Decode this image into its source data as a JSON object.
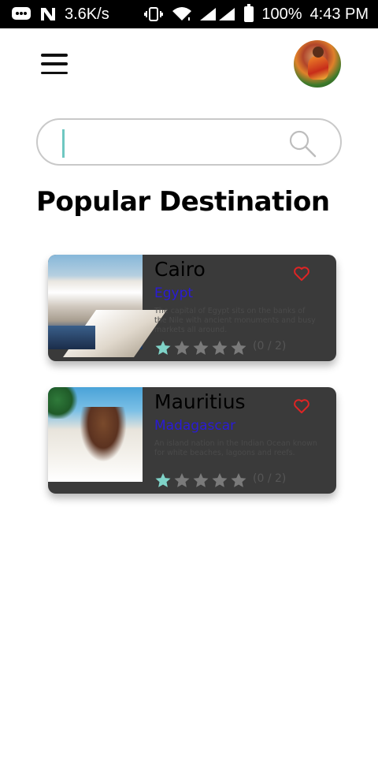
{
  "status_bar": {
    "network_speed": "3.6K/s",
    "battery": "100%",
    "time": "4:43 PM",
    "icons": [
      "message-icon",
      "n-icon",
      "vibrate-icon",
      "wifi-icon",
      "signal-icon",
      "battery-icon"
    ]
  },
  "header": {
    "menu_icon": "hamburger-menu-icon",
    "avatar": "user-avatar"
  },
  "search": {
    "value": "",
    "placeholder": "",
    "icon": "search-icon"
  },
  "page_title": "Popular Destination",
  "colors": {
    "card_bg": "#3a3a3a",
    "country": "#2a1bd6",
    "heart": "#e02424",
    "star_filled": "#7fd3c8",
    "star_empty": "#7a7a7a"
  },
  "destinations": [
    {
      "name": "Cairo",
      "country": "Egypt",
      "description": "The capital of Egypt sits on the banks of the Nile with ancient monuments and busy markets all around.",
      "rating": 1,
      "rating_max": 5,
      "rating_text": "(0 / 2)",
      "image": "cairo-coast-photo"
    },
    {
      "name": "Mauritius",
      "country": "Madagascar",
      "description": "An island nation in the Indian Ocean known for white beaches, lagoons and reefs.",
      "rating": 1,
      "rating_max": 5,
      "rating_text": "(0 / 2)",
      "image": "beach-children-photo"
    }
  ]
}
